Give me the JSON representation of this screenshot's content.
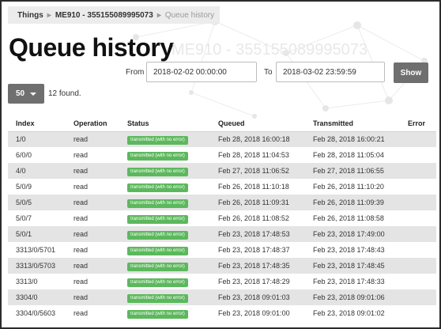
{
  "breadcrumb": {
    "items": [
      "Things",
      "ME910 - 355155089995073"
    ],
    "separator": "▸",
    "current": "Queue history"
  },
  "page": {
    "title": "Queue history",
    "background_text": "ME910 - 355155089995073"
  },
  "filters": {
    "from_label": "From",
    "from_value": "2018-02-02 00:00:00",
    "to_label": "To",
    "to_value": "2018-03-02 23:59:59",
    "show_label": "Show"
  },
  "pagination": {
    "page_size": "50",
    "found_text": "12 found."
  },
  "table": {
    "columns": [
      "Index",
      "Operation",
      "Status",
      "Queued",
      "Transmitted",
      "Error"
    ],
    "rows": [
      {
        "index": "1/0",
        "operation": "read",
        "status": "transmitted (with no error)",
        "queued": "Feb 28, 2018 16:00:18",
        "transmitted": "Feb 28, 2018 16:00:21",
        "error": ""
      },
      {
        "index": "6/0/0",
        "operation": "read",
        "status": "transmitted (with no error)",
        "queued": "Feb 28, 2018 11:04:53",
        "transmitted": "Feb 28, 2018 11:05:04",
        "error": ""
      },
      {
        "index": "4/0",
        "operation": "read",
        "status": "transmitted (with no error)",
        "queued": "Feb 27, 2018 11:06:52",
        "transmitted": "Feb 27, 2018 11:06:55",
        "error": ""
      },
      {
        "index": "5/0/9",
        "operation": "read",
        "status": "transmitted (with no error)",
        "queued": "Feb 26, 2018 11:10:18",
        "transmitted": "Feb 26, 2018 11:10:20",
        "error": ""
      },
      {
        "index": "5/0/5",
        "operation": "read",
        "status": "transmitted (with no error)",
        "queued": "Feb 26, 2018 11:09:31",
        "transmitted": "Feb 26, 2018 11:09:39",
        "error": ""
      },
      {
        "index": "5/0/7",
        "operation": "read",
        "status": "transmitted (with no error)",
        "queued": "Feb 26, 2018 11:08:52",
        "transmitted": "Feb 26, 2018 11:08:58",
        "error": ""
      },
      {
        "index": "5/0/1",
        "operation": "read",
        "status": "transmitted (with no error)",
        "queued": "Feb 23, 2018 17:48:53",
        "transmitted": "Feb 23, 2018 17:49:00",
        "error": ""
      },
      {
        "index": "3313/0/5701",
        "operation": "read",
        "status": "transmitted (with no error)",
        "queued": "Feb 23, 2018 17:48:37",
        "transmitted": "Feb 23, 2018 17:48:43",
        "error": ""
      },
      {
        "index": "3313/0/5703",
        "operation": "read",
        "status": "transmitted (with no error)",
        "queued": "Feb 23, 2018 17:48:35",
        "transmitted": "Feb 23, 2018 17:48:45",
        "error": ""
      },
      {
        "index": "3313/0",
        "operation": "read",
        "status": "transmitted (with no error)",
        "queued": "Feb 23, 2018 17:48:29",
        "transmitted": "Feb 23, 2018 17:48:33",
        "error": ""
      },
      {
        "index": "3304/0",
        "operation": "read",
        "status": "transmitted (with no error)",
        "queued": "Feb 23, 2018 09:01:03",
        "transmitted": "Feb 23, 2018 09:01:06",
        "error": ""
      },
      {
        "index": "3304/0/5603",
        "operation": "read",
        "status": "transmitted (with no error)",
        "queued": "Feb 23, 2018 09:01:00",
        "transmitted": "Feb 23, 2018 09:01:02",
        "error": ""
      }
    ]
  },
  "colors": {
    "status_success": "#5cb85c",
    "button_bg": "#6f6f6f",
    "row_stripe": "#e4e4e4"
  }
}
